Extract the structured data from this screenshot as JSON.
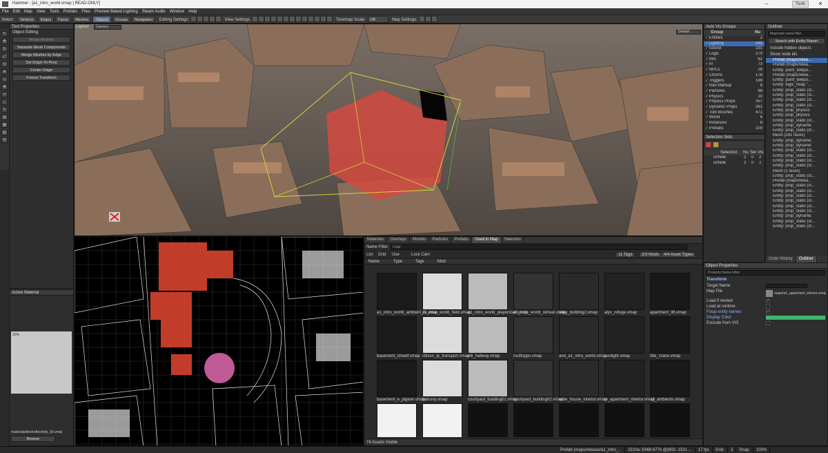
{
  "window": {
    "title": "Hammer - [a1_intro_world.vmap | READ-ONLY]",
    "app_label": "Tools",
    "min": "–",
    "max": "□",
    "close": "✕"
  },
  "menu": [
    "File",
    "Edit",
    "Map",
    "View",
    "Tools",
    "Prefabs",
    "Files",
    "Preview Baked Lighting",
    "Steam Audio",
    "Window",
    "Help"
  ],
  "toolbar": {
    "select_label": "Select:",
    "modes": [
      "Vertices",
      "Edges",
      "Faces",
      "Meshes",
      "Objects",
      "Groups"
    ],
    "navigation": "Navigation",
    "editing_settings": "Editing Settings:",
    "view_settings": "View Settings:",
    "tonemap": "Tonemap Scale:",
    "tonemap_value": "Off",
    "map_settings": "Map Settings:"
  },
  "tool_properties": {
    "title": "Tool Properties",
    "section": "Object Editing",
    "buttons": [
      "Merge Meshes",
      "Separate Mesh Components",
      "Merge Meshes by Edge",
      "Set Origin To Pivot",
      "Center Origin",
      "Freeze Transform"
    ]
  },
  "active_material": {
    "title": "Active Material",
    "path": "materials/dev/reflectivity_30.vmat",
    "browse": "Browse",
    "preview_text": "30%"
  },
  "viewport3d": {
    "layout_label": "Layout:",
    "camera_label": "Camera",
    "dropdown": "Default"
  },
  "auto_vis": {
    "title": "Auto Vis Groups",
    "col_group": "Group",
    "col_num": "Nu",
    "rows": [
      [
        "Entities",
        "2"
      ],
      [
        "Lighting",
        "585"
      ],
      [
        "Sound",
        "191"
      ],
      [
        "Logic",
        "270"
      ],
      [
        "Info",
        "61"
      ],
      [
        "AI",
        "73"
      ],
      [
        "NPCs",
        "28"
      ],
      [
        "Chorns",
        "176"
      ],
      [
        "Triggers",
        "199"
      ],
      [
        "Nav Markup",
        "8"
      ],
      [
        "Particles",
        "68"
      ],
      [
        "Physics",
        "20"
      ],
      [
        "Physics Props",
        "357"
      ],
      [
        "Dynamic Props",
        "261"
      ],
      [
        "Tool Brushes",
        "471"
      ],
      [
        "World",
        "6"
      ],
      [
        "Instances",
        "8"
      ],
      [
        "Prefabs",
        "100"
      ]
    ]
  },
  "selection_sets": {
    "title": "Selection Sets",
    "col_sel": "Selection",
    "col_nu": "Nu",
    "col_sel2": "Sel",
    "col_vis": "Vis",
    "rows": [
      [
        "unhide",
        "2",
        "0",
        "2"
      ],
      [
        "unhide",
        "2",
        "0",
        "2"
      ]
    ]
  },
  "outliner": {
    "title": "Outliner",
    "filter_placeholder": "Mapnode name filter",
    "search_button": "Search with Entity Report",
    "include_hidden": "Include hidden objects",
    "show_node_ids": "Show node ids",
    "rows": [
      "Prefab (maps/relea...",
      "Prefab (maps/relea...",
      "Entity: point_telepo...",
      "Prefab (maps/relea...",
      "Entity: point_telepo...",
      "Entity: logic_relay \"...",
      "Entity: prop_static (st...",
      "Entity: prop_static (st...",
      "Entity: prop_static (st...",
      "Entity: prop_static (st...",
      "Entity: prop_physics",
      "Entity: prop_physics",
      "Entity: prop_static (st...",
      "Entity: prop_dynamic",
      "Entity: prop_static (st...",
      "Mesh (291 faces)",
      "Entity: prop_dynamic",
      "Entity: prop_dynamic",
      "Entity: prop_static (st...",
      "Entity: prop_static (st...",
      "Entity: prop_static (st...",
      "Entity: prop_static (st...",
      "Mesh (1 faces)",
      "Entity: prop_static (st...",
      "Prefab (maps/relea...",
      "Entity: prop_static (st...",
      "Entity: prop_static (st...",
      "Entity: prop_static (st...",
      "Entity: prop_static (st...",
      "Entity: prop_static (st...",
      "Entity: prop_static (st...",
      "Entity: prop_dynamic",
      "Entity: prop_static (st...",
      "Entity: prop_static (st..."
    ],
    "tabs": [
      "Undo History",
      "Outliner"
    ]
  },
  "object_properties": {
    "title": "Object Properties",
    "filter_placeholder": "Property Name Filter",
    "section": "Transform",
    "rows": [
      [
        "Target Name",
        ""
      ],
      [
        "Map File",
        "maps/a1_apartment_interior.vmap"
      ],
      [
        "Load if nested",
        ""
      ],
      [
        "Load at runtime",
        ""
      ],
      [
        "Fixup entity names",
        ""
      ],
      [
        "Display Color",
        ""
      ],
      [
        "Exclude from VIS",
        ""
      ]
    ]
  },
  "assets": {
    "tabs": [
      "Materials",
      "Overlays",
      "Models",
      "Particles",
      "Prefabs",
      "Used in Map",
      "Selection"
    ],
    "name_filter_label": "Name Filter:",
    "name_filter_value": "Clear",
    "view_list": "List",
    "view_grid": "Grid",
    "use_label": "Use",
    "lock_cam": "Lock Cam",
    "tags_btn": "11 Tags",
    "mods_btn": "2/3 Mods",
    "types_btn": "4/4 Asset Types",
    "cols": [
      "Name",
      "Type",
      "Tags",
      "Mod"
    ],
    "footer": "74 Assets Visible",
    "items": [
      "a1_intro_world_ambient_fx.vmap",
      "a1_intro_world_field.vmap",
      "a1_intro_world_playerstart.vmap",
      "a1_intro_world_retreat.vmap",
      "alley_building2.vmap",
      "alyx_refuge.vmap",
      "apartment_lift.vmap",
      "basement_streetf.vmap",
      "citizen_lp_transport.vmap",
      "elli_hallway.vmap",
      "rooftopps.vmap",
      "and_a1_intro_world.vmap",
      "sunlight.vmap",
      "title_crane.vmap",
      "basement_e_pigeon.vmap",
      "balcony.vmap",
      "courtyard_building01.vmap",
      "courtyard_building02.vmap",
      "wide_house_interior.vmap",
      "tv_apartment_interior.vmap",
      "a1_ambients.vmap",
      "",
      "",
      "",
      "",
      "",
      "",
      ""
    ]
  },
  "status": {
    "path": "Prefab (maps/release/a1_intro_...",
    "dims": "1510w 2048l 677h @(603 -1531 ...",
    "fps": "17 fps",
    "grid_label": "Grid:",
    "grid": "2",
    "snap_label": "Snap:",
    "zoom": "100%"
  }
}
